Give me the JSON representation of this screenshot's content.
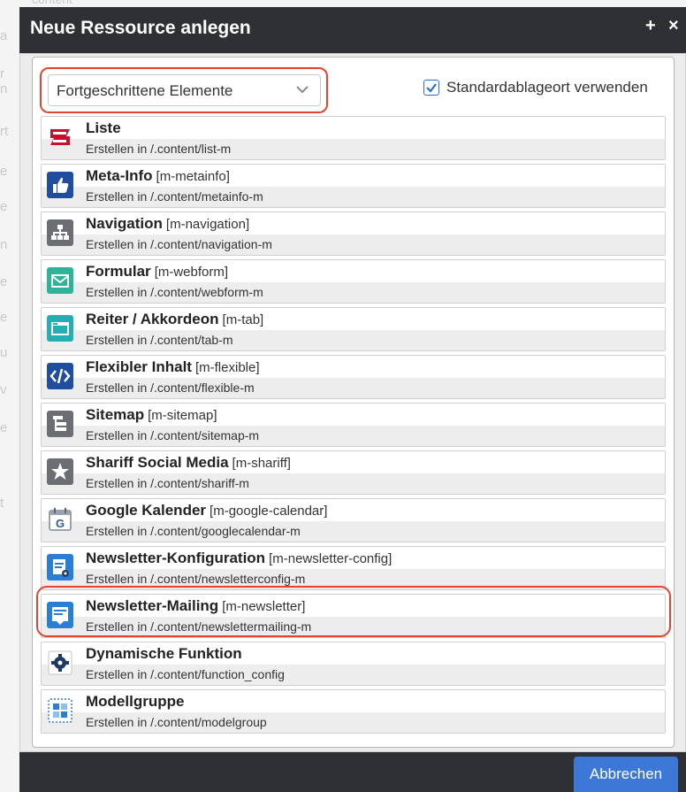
{
  "dialog": {
    "title": "Neue Ressource anlegen",
    "add_symbol": "+",
    "close_symbol": "×"
  },
  "filter": {
    "selected": "Fortgeschrittene Elemente"
  },
  "default_location": {
    "label": "Standardablageort verwenden",
    "checked": true
  },
  "items": [
    {
      "name": "Liste",
      "type": "",
      "sub": "Erstellen in /.content/list-m",
      "icon": "list-icon",
      "color": "#c8102e"
    },
    {
      "name": "Meta-Info",
      "type": "[m-metainfo]",
      "sub": "Erstellen in /.content/metainfo-m",
      "icon": "thumbs-up-icon",
      "color": "#1f4e9e"
    },
    {
      "name": "Navigation",
      "type": "[m-navigation]",
      "sub": "Erstellen in /.content/navigation-m",
      "icon": "sitemap-tree-icon",
      "color": "#6b6e72"
    },
    {
      "name": "Formular",
      "type": "[m-webform]",
      "sub": "Erstellen in /.content/webform-m",
      "icon": "envelope-icon",
      "color": "#2eb39a"
    },
    {
      "name": "Reiter / Akkordeon",
      "type": "[m-tab]",
      "sub": "Erstellen in /.content/tab-m",
      "icon": "tab-window-icon",
      "color": "#26aeb5"
    },
    {
      "name": "Flexibler Inhalt",
      "type": "[m-flexible]",
      "sub": "Erstellen in /.content/flexible-m",
      "icon": "code-icon",
      "color": "#1f4e9e"
    },
    {
      "name": "Sitemap",
      "type": "[m-sitemap]",
      "sub": "Erstellen in /.content/sitemap-m",
      "icon": "sitemap-list-icon",
      "color": "#6b6e72"
    },
    {
      "name": "Shariff Social Media",
      "type": "[m-shariff]",
      "sub": "Erstellen in /.content/shariff-m",
      "icon": "star-icon",
      "color": "#6b6e72"
    },
    {
      "name": "Google Kalender",
      "type": "[m-google-calendar]",
      "sub": "Erstellen in /.content/googlecalendar-m",
      "icon": "google-calendar-icon",
      "color": "#2f5b9c"
    },
    {
      "name": "Newsletter-Konfiguration",
      "type": "[m-newsletter-config]",
      "sub": "Erstellen in /.content/newsletterconfig-m",
      "icon": "newsletter-config-icon",
      "color": "#2a7fd4"
    },
    {
      "name": "Newsletter-Mailing",
      "type": "[m-newsletter]",
      "sub": "Erstellen in /.content/newslettermailing-m",
      "icon": "newsletter-icon",
      "color": "#2a7fd4"
    },
    {
      "name": "Dynamische Funktion",
      "type": "",
      "sub": "Erstellen in /.content/function_config",
      "icon": "gear-icon",
      "color": "#1e3a66"
    },
    {
      "name": "Modellgruppe",
      "type": "",
      "sub": "Erstellen in /.content/modelgroup",
      "icon": "model-group-icon",
      "color": "#2a7fd4"
    }
  ],
  "footer": {
    "cancel_label": "Abbrechen"
  },
  "background": {
    "top_text": "content",
    "side_letters": [
      "a",
      "r",
      "n",
      "rt",
      "e",
      "e",
      "n",
      "e",
      "e",
      "u",
      "v",
      "e",
      "t"
    ]
  },
  "colors": {
    "titlebar": "#2e3033",
    "accent_button": "#3c78d8",
    "highlight_ring": "#e2442d"
  }
}
